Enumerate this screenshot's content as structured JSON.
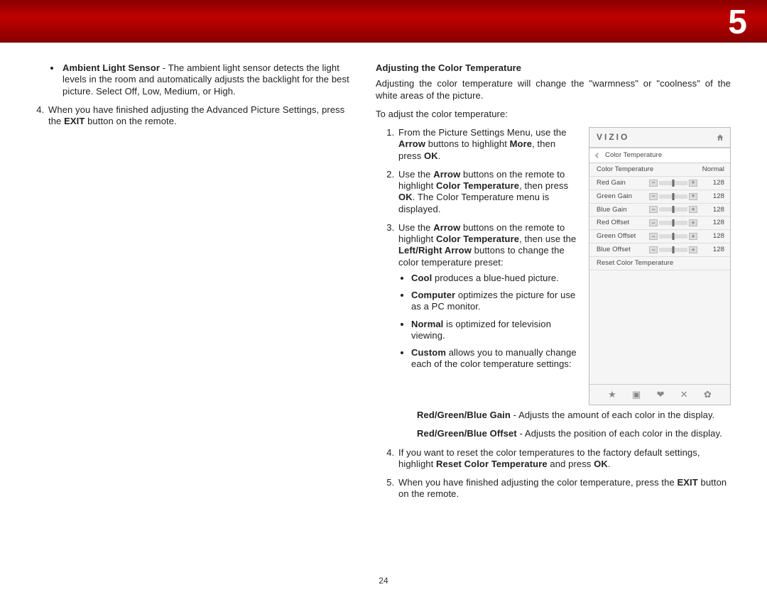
{
  "chapter_number": "5",
  "page_number": "24",
  "left": {
    "ambient_bullet": {
      "title": "Ambient Light Sensor",
      "text": " - The ambient light sensor detects the light levels in the room and automatically adjusts the backlight for the best picture. Select Off, Low, Medium, or High."
    },
    "step4_prefix": "When you have finished adjusting the Advanced Picture Settings, press the ",
    "step4_bold": "EXIT",
    "step4_suffix": " button on the remote."
  },
  "right": {
    "heading": "Adjusting the Color Temperature",
    "intro": "Adjusting the color temperature will change the \"warmness\" or \"coolness\" of the white areas of the picture.",
    "lead": "To adjust the color temperature:",
    "step1": {
      "a": "From the Picture Settings Menu, use the ",
      "arrow": "Arrow",
      "b": " buttons to highlight ",
      "more": "More",
      "c": ", then press ",
      "ok": "OK",
      "d": "."
    },
    "step2": {
      "a": "Use the ",
      "arrow": "Arrow",
      "b": " buttons on the remote to highlight ",
      "ct": "Color Temperature",
      "c": ", then press ",
      "ok": "OK",
      "d": ". The Color Temperature menu is displayed."
    },
    "step3": {
      "a": "Use the ",
      "arrow": "Arrow",
      "b": " buttons on the remote to highlight ",
      "ct": "Color Temperature",
      "c": ", then use the ",
      "lr": "Left/Right Arrow",
      "d": " buttons to change the color temperature preset:"
    },
    "presets": {
      "cool_b": "Cool",
      "cool_t": " produces a blue-hued picture.",
      "computer_b": "Computer",
      "computer_t": " optimizes the picture for use as a PC monitor.",
      "normal_b": "Normal",
      "normal_t": " is optimized for television viewing.",
      "custom_b": "Custom",
      "custom_t": " allows you to manually change each of the color temperature settings:"
    },
    "gain": {
      "b": "Red/Green/Blue Gain",
      "t": " - Adjusts the amount of each color in the display."
    },
    "offset": {
      "b": "Red/Green/Blue Offset",
      "t": " - Adjusts the position of each color in the display."
    },
    "step4": {
      "a": "If you want to reset the color temperatures to the factory default settings, highlight ",
      "rct": "Reset Color Temperature",
      "b": " and press ",
      "ok": "OK",
      "c": "."
    },
    "step5": {
      "a": "When you have finished adjusting the color temperature, press the ",
      "exit": "EXIT",
      "b": " button on the remote."
    }
  },
  "osd": {
    "brand": "VIZIO",
    "crumb": "Color Temperature",
    "selected_label": "Color Temperature",
    "selected_value": "Normal",
    "sliders": {
      "red_gain": {
        "label": "Red Gain",
        "value": "128"
      },
      "green_gain": {
        "label": "Green Gain",
        "value": "128"
      },
      "blue_gain": {
        "label": "Blue Gain",
        "value": "128"
      },
      "red_off": {
        "label": "Red Offset",
        "value": "128"
      },
      "green_off": {
        "label": "Green Offset",
        "value": "128"
      },
      "blue_off": {
        "label": "Blue Offset",
        "value": "128"
      }
    },
    "reset": "Reset Color Temperature",
    "footer_icons": {
      "star": "★",
      "pip": "▣",
      "wide": "❤",
      "x": "✕",
      "gear": "✿"
    }
  }
}
